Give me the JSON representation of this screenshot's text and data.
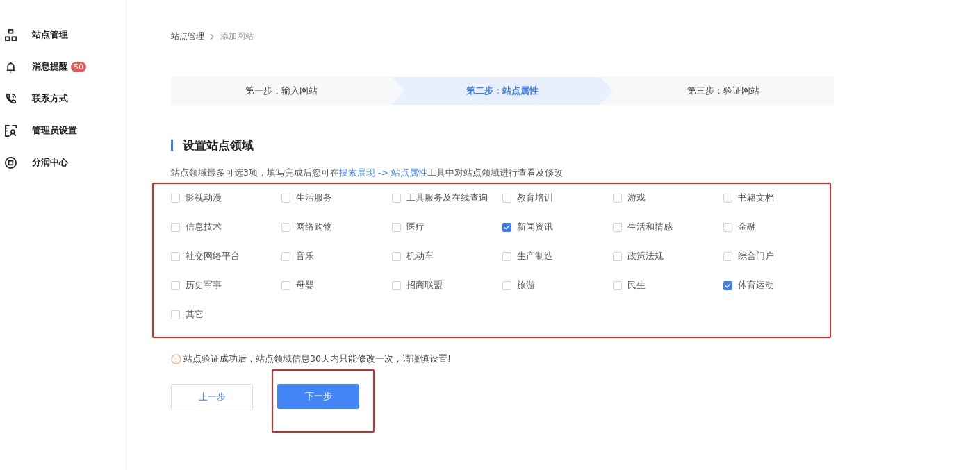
{
  "sidebar": {
    "items": [
      {
        "kind": "network",
        "label": "站点管理",
        "selected": false
      },
      {
        "kind": "bell",
        "label": "消息提醒",
        "badge": "50",
        "selected": false
      },
      {
        "kind": "phone",
        "label": "联系方式",
        "selected": false
      },
      {
        "kind": "admin",
        "label": "管理员设置",
        "selected": false
      },
      {
        "kind": "share",
        "label": "分润中心",
        "selected": false
      }
    ]
  },
  "breadcrumb": [
    "站点管理",
    "添加网站"
  ],
  "steps": [
    {
      "label": "第一步：输入网站",
      "selected": false
    },
    {
      "label": "第二步：站点属性",
      "selected": true
    },
    {
      "label": "第三步：验证网站",
      "selected": false
    }
  ],
  "section_title": "设置站点领域",
  "description": "站点领域最多可选3项，填写完成后您可在",
  "description_link": "搜索展现 -> 站点属性",
  "description_tail": "工具中对站点领域进行查看及修改",
  "domains_highlighted": true,
  "domains": [
    {
      "label": "影视动漫",
      "checked": false
    },
    {
      "label": "生活服务",
      "checked": false
    },
    {
      "label": "工具服务及在线查询",
      "checked": false
    },
    {
      "label": "教育培训",
      "checked": false
    },
    {
      "label": "游戏",
      "checked": false
    },
    {
      "label": "书籍文档",
      "checked": false
    },
    {
      "label": "信息技术",
      "checked": false
    },
    {
      "label": "网络购物",
      "checked": false
    },
    {
      "label": "医疗",
      "checked": false
    },
    {
      "label": "新闻资讯",
      "checked": true
    },
    {
      "label": "生活和情感",
      "checked": false
    },
    {
      "label": "金融",
      "checked": false
    },
    {
      "label": "社交网络平台",
      "checked": false
    },
    {
      "label": "音乐",
      "checked": false
    },
    {
      "label": "机动车",
      "checked": false
    },
    {
      "label": "生产制造",
      "checked": false
    },
    {
      "label": "政策法规",
      "checked": false
    },
    {
      "label": "综合门户",
      "checked": false
    },
    {
      "label": "历史军事",
      "checked": false
    },
    {
      "label": "母婴",
      "checked": false
    },
    {
      "label": "招商联盟",
      "checked": false
    },
    {
      "label": "旅游",
      "checked": false
    },
    {
      "label": "民生",
      "checked": false
    },
    {
      "label": "体育运动",
      "checked": true
    },
    {
      "label": "其它",
      "checked": false
    }
  ],
  "warning": "站点验证成功后，站点领域信息30天内只能修改一次，请谨慎设置!",
  "buttons": [
    {
      "label": "上一步",
      "kind": "secondary",
      "highlighted": false
    },
    {
      "label": "下一步",
      "kind": "primary",
      "highlighted": true
    }
  ]
}
